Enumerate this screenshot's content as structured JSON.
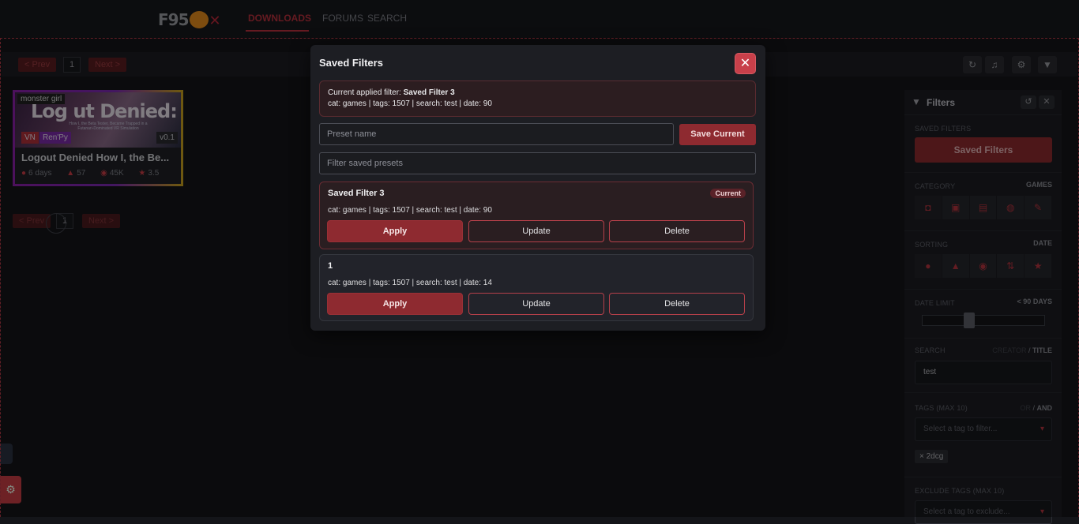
{
  "topbar": {
    "logo_text": "F95",
    "nav": {
      "downloads": "DOWNLOADS",
      "forums": "FORUMS",
      "search": "SEARCH"
    }
  },
  "pagination": {
    "prev": "< Prev",
    "page": "1",
    "next": "Next >"
  },
  "card": {
    "tag": "monster girl",
    "image_title": "Log ut Denied:",
    "image_subtitle": "How I, the Beta Tester, Became Trapped in a Futanari-Dominated VR Simulation",
    "badges": [
      "VN",
      "Ren'Py"
    ],
    "version": "v0.1",
    "title": "Logout Denied How I, the Be...",
    "stats": {
      "age": "6 days",
      "likes": "57",
      "views": "45K",
      "rating": "3.5"
    }
  },
  "filters_panel": {
    "title": "Filters",
    "saved_filters_label": "SAVED FILTERS",
    "saved_filters_button": "Saved Filters",
    "category_label": "CATEGORY",
    "category_value": "GAMES",
    "sorting_label": "SORTING",
    "sorting_value": "DATE",
    "date_limit_label": "DATE LIMIT",
    "date_limit_value": "< 90 DAYS",
    "search_label": "SEARCH",
    "search_mode_creator": "CREATOR",
    "search_mode_sep": "/",
    "search_mode_title": "TITLE",
    "search_value": "test",
    "tags_label": "TAGS (MAX 10)",
    "tags_mode_or": "OR",
    "tags_mode_and": "AND",
    "tags_placeholder": "Select a tag to filter...",
    "tag_chip": "2dcg",
    "exclude_label": "EXCLUDE TAGS (MAX 10)",
    "exclude_placeholder": "Select a tag to exclude..."
  },
  "modal": {
    "title": "Saved Filters",
    "close": "✕",
    "applied_prefix": "Current applied filter:",
    "applied_name": "Saved Filter 3",
    "applied_meta": "cat: games | tags: 1507 | search: test | date: 90",
    "preset_name_placeholder": "Preset name",
    "save_current": "Save Current",
    "filter_placeholder": "Filter saved presets",
    "presets": [
      {
        "name": "Saved Filter 3",
        "meta": "cat: games | tags: 1507 | search: test | date: 90",
        "badge": "Current",
        "apply": "Apply",
        "update": "Update",
        "delete": "Delete"
      },
      {
        "name": "1",
        "meta": "cat: games | tags: 1507 | search: test | date: 14",
        "apply": "Apply",
        "update": "Update",
        "delete": "Delete"
      }
    ]
  },
  "colors": {
    "accent": "#8e2a30",
    "close": "#c8404a",
    "bg": "#141519"
  }
}
